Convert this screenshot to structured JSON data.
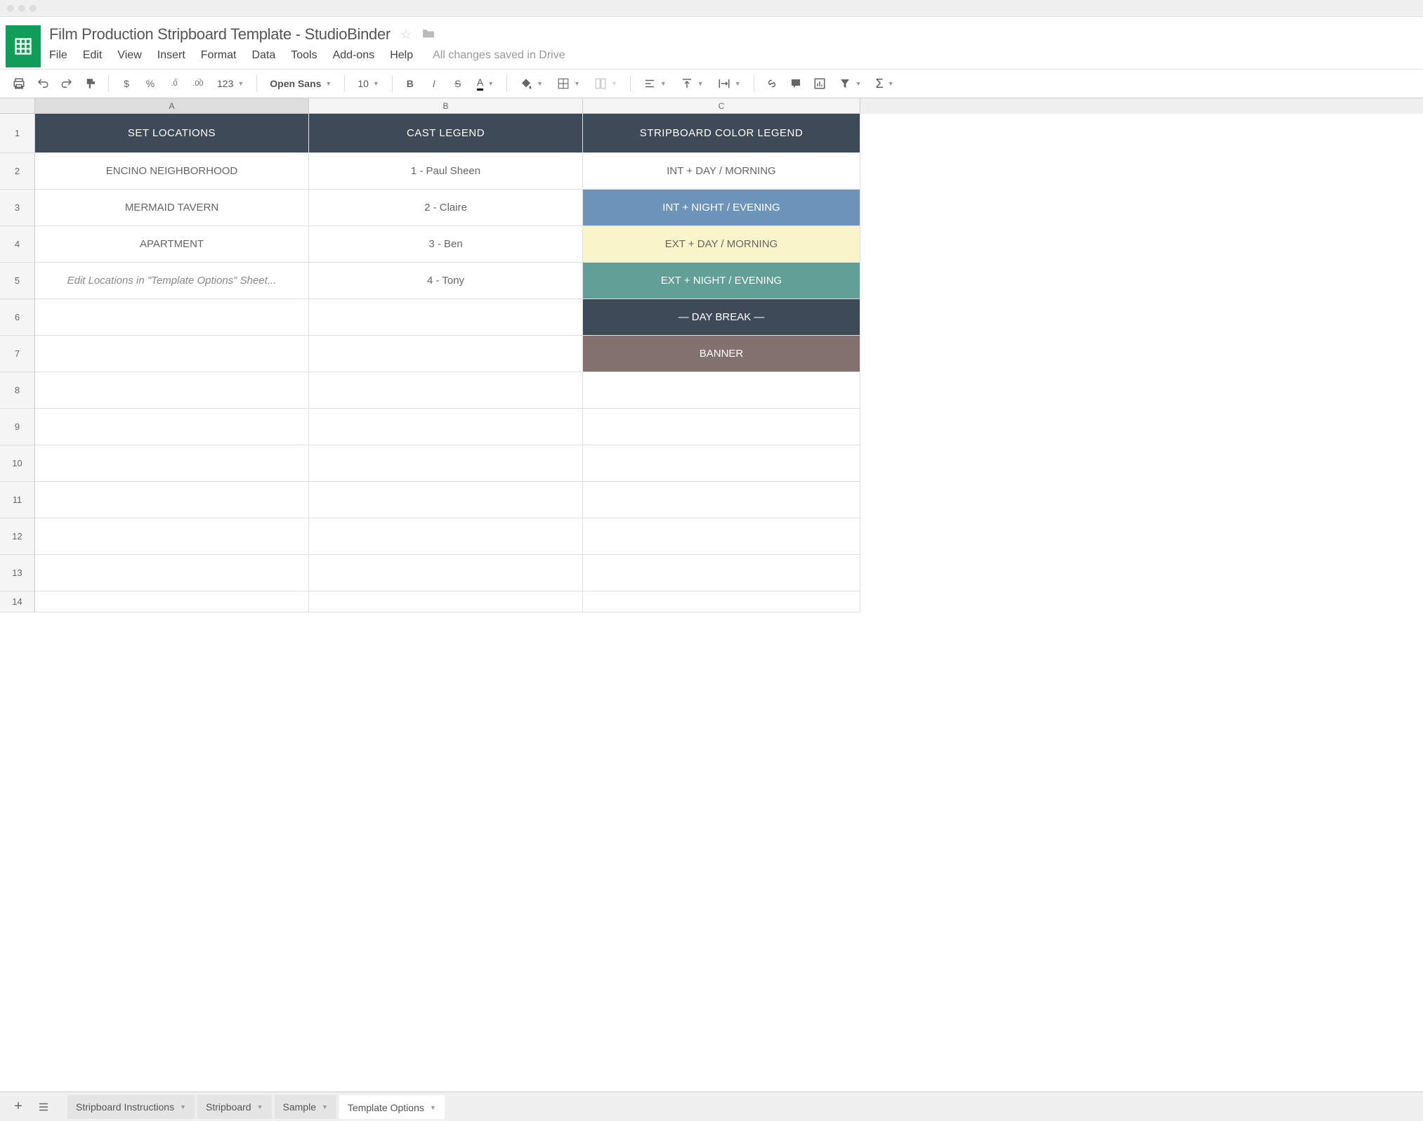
{
  "doc_title": "Film Production Stripboard Template  -  StudioBinder",
  "menus": {
    "file": "File",
    "edit": "Edit",
    "view": "View",
    "insert": "Insert",
    "format": "Format",
    "data": "Data",
    "tools": "Tools",
    "addons": "Add-ons",
    "help": "Help"
  },
  "save_status": "All changes saved in Drive",
  "toolbar": {
    "currency": "$",
    "percent": "%",
    "dec_decrease": ".0",
    "dec_increase": ".00",
    "number_format": "123",
    "font": "Open Sans",
    "font_size": "10",
    "bold": "B",
    "italic": "I",
    "strike": "S",
    "text_color": "A",
    "sigma": "Σ"
  },
  "columns": {
    "a": "A",
    "b": "B",
    "c": "C"
  },
  "rows": [
    "1",
    "2",
    "3",
    "4",
    "5",
    "6",
    "7",
    "8",
    "9",
    "10",
    "11",
    "12",
    "13",
    "14"
  ],
  "headers": {
    "set_locations": "SET LOCATIONS",
    "cast_legend": "CAST LEGEND",
    "stripboard_legend": "STRIPBOARD COLOR LEGEND"
  },
  "locations": {
    "r2": "ENCINO NEIGHBORHOOD",
    "r3": "MERMAID TAVERN",
    "r4": "APARTMENT",
    "r5": "Edit Locations in \"Template Options\" Sheet..."
  },
  "cast": {
    "r2": "1 - Paul Sheen",
    "r3": "2 - Claire",
    "r4": "3 - Ben",
    "r5": "4 - Tony"
  },
  "legend": {
    "r2": "INT  +  DAY / MORNING",
    "r3": "INT  +  NIGHT / EVENING",
    "r4": "EXT  +  DAY / MORNING",
    "r5": "EXT  +  NIGHT / EVENING",
    "r6": "— DAY BREAK —",
    "r7": "BANNER"
  },
  "sheets": {
    "s1": "Stripboard Instructions",
    "s2": "Stripboard",
    "s3": "Sample",
    "s4": "Template Options"
  }
}
